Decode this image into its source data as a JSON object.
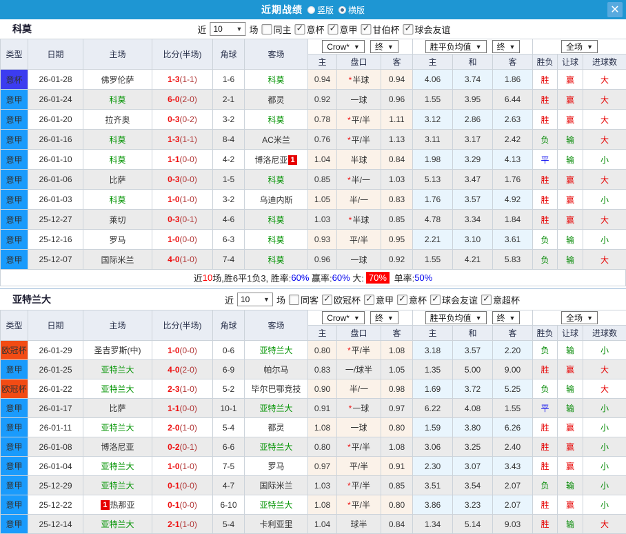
{
  "titlebar": {
    "title": "近期战绩",
    "radio_vertical": "竖版",
    "radio_horizontal": "横版",
    "close": "✕"
  },
  "filter_labels": {
    "near": "近",
    "count": "10",
    "games": "场"
  },
  "columns": {
    "type": "类型",
    "date": "日期",
    "home": "主场",
    "score": "比分(半场)",
    "corner": "角球",
    "away": "客场",
    "sub": [
      "主",
      "盘口",
      "客",
      "主",
      "和",
      "客",
      "胜负",
      "让球",
      "进球数"
    ]
  },
  "dropdowns": {
    "bookmaker": "Crow*",
    "final1": "终",
    "avg": "胜平负均值",
    "final2": "终",
    "scope": "全场"
  },
  "league_colors": {
    "意甲": "#1a9bfc",
    "意杯": "#3c3cf0",
    "欧冠杯": "#f24b14"
  },
  "result_colors": {
    "胜": "#e60000",
    "赢": "#e60000",
    "大": "#e60000",
    "负": "#008800",
    "输": "#008800",
    "小": "#008800",
    "平": "#0000ee"
  },
  "sections": [
    {
      "team": "科莫",
      "filter": {
        "same": "同主",
        "leagues": [
          "意杯",
          "意甲",
          "甘伯杯",
          "球会友谊"
        ]
      },
      "rows": [
        {
          "lg": "意杯",
          "date": "26-01-28",
          "home": "佛罗伦萨",
          "score": "1-3",
          "half": "1-1",
          "corner": "1-6",
          "away": "科莫",
          "o1": "0.94",
          "star": true,
          "hc": "半球",
          "o2": "0.94",
          "a1": "4.06",
          "a2": "3.74",
          "a3": "1.86",
          "r1": "胜",
          "r2": "赢",
          "r3": "大"
        },
        {
          "lg": "意甲",
          "date": "26-01-24",
          "home": "科莫",
          "score": "6-0",
          "half": "2-0",
          "corner": "2-1",
          "away": "都灵",
          "o1": "0.92",
          "star": false,
          "hc": "一球",
          "o2": "0.96",
          "a1": "1.55",
          "a2": "3.95",
          "a3": "6.44",
          "r1": "胜",
          "r2": "赢",
          "r3": "大"
        },
        {
          "lg": "意甲",
          "date": "26-01-20",
          "home": "拉齐奥",
          "score": "0-3",
          "half": "0-2",
          "corner": "3-2",
          "away": "科莫",
          "o1": "0.78",
          "star": true,
          "hc": "平/半",
          "o2": "1.11",
          "a1": "3.12",
          "a2": "2.86",
          "a3": "2.63",
          "r1": "胜",
          "r2": "赢",
          "r3": "大"
        },
        {
          "lg": "意甲",
          "date": "26-01-16",
          "home": "科莫",
          "score": "1-3",
          "half": "1-1",
          "corner": "8-4",
          "away": "AC米兰",
          "o1": "0.76",
          "star": true,
          "hc": "平/半",
          "o2": "1.13",
          "a1": "3.11",
          "a2": "3.17",
          "a3": "2.42",
          "r1": "负",
          "r2": "输",
          "r3": "大"
        },
        {
          "lg": "意甲",
          "date": "26-01-10",
          "home": "科莫",
          "score": "1-1",
          "half": "0-0",
          "corner": "4-2",
          "away": "博洛尼亚",
          "arc": "1",
          "arc_pos": "right",
          "o1": "1.04",
          "star": false,
          "hc": "半球",
          "o2": "0.84",
          "a1": "1.98",
          "a2": "3.29",
          "a3": "4.13",
          "r1": "平",
          "r2": "输",
          "r3": "小"
        },
        {
          "lg": "意甲",
          "date": "26-01-06",
          "home": "比萨",
          "score": "0-3",
          "half": "0-0",
          "corner": "1-5",
          "away": "科莫",
          "o1": "0.85",
          "star": true,
          "hc": "半/一",
          "o2": "1.03",
          "a1": "5.13",
          "a2": "3.47",
          "a3": "1.76",
          "r1": "胜",
          "r2": "赢",
          "r3": "大"
        },
        {
          "lg": "意甲",
          "date": "26-01-03",
          "home": "科莫",
          "score": "1-0",
          "half": "1-0",
          "corner": "3-2",
          "away": "乌迪内斯",
          "o1": "1.05",
          "star": false,
          "hc": "半/一",
          "o2": "0.83",
          "a1": "1.76",
          "a2": "3.57",
          "a3": "4.92",
          "r1": "胜",
          "r2": "赢",
          "r3": "小"
        },
        {
          "lg": "意甲",
          "date": "25-12-27",
          "home": "莱切",
          "score": "0-3",
          "half": "0-1",
          "corner": "4-6",
          "away": "科莫",
          "o1": "1.03",
          "star": true,
          "hc": "半球",
          "o2": "0.85",
          "a1": "4.78",
          "a2": "3.34",
          "a3": "1.84",
          "r1": "胜",
          "r2": "赢",
          "r3": "大"
        },
        {
          "lg": "意甲",
          "date": "25-12-16",
          "home": "罗马",
          "score": "1-0",
          "half": "0-0",
          "corner": "6-3",
          "away": "科莫",
          "o1": "0.93",
          "star": false,
          "hc": "平/半",
          "o2": "0.95",
          "a1": "2.21",
          "a2": "3.10",
          "a3": "3.61",
          "r1": "负",
          "r2": "输",
          "r3": "小"
        },
        {
          "lg": "意甲",
          "date": "25-12-07",
          "home": "国际米兰",
          "score": "4-0",
          "half": "1-0",
          "corner": "7-4",
          "away": "科莫",
          "o1": "0.96",
          "star": false,
          "hc": "一球",
          "o2": "0.92",
          "a1": "1.55",
          "a2": "4.21",
          "a3": "5.83",
          "r1": "负",
          "r2": "输",
          "r3": "大"
        }
      ],
      "summary": [
        {
          "t": "近"
        },
        {
          "t": "10",
          "s": "red"
        },
        {
          "t": "场,胜6平1负3, 胜率:"
        },
        {
          "t": "60%",
          "s": "blue"
        },
        {
          "t": " 赢率:"
        },
        {
          "t": "60%",
          "s": "blue"
        },
        {
          "t": " 大:"
        },
        {
          "t": "70%",
          "s": "redbg"
        },
        {
          "t": " 单率:"
        },
        {
          "t": "50%",
          "s": "blue"
        }
      ]
    },
    {
      "team": "亚特兰大",
      "filter": {
        "same": "同客",
        "leagues": [
          "欧冠杯",
          "意甲",
          "意杯",
          "球会友谊",
          "意超杯"
        ]
      },
      "rows": [
        {
          "lg": "欧冠杯",
          "date": "26-01-29",
          "home": "圣吉罗斯(中)",
          "score": "1-0",
          "half": "0-0",
          "corner": "0-6",
          "away": "亚特兰大",
          "o1": "0.80",
          "star": true,
          "hc": "平/半",
          "o2": "1.08",
          "a1": "3.18",
          "a2": "3.57",
          "a3": "2.20",
          "r1": "负",
          "r2": "输",
          "r3": "小"
        },
        {
          "lg": "意甲",
          "date": "26-01-25",
          "home": "亚特兰大",
          "score": "4-0",
          "half": "2-0",
          "corner": "6-9",
          "away": "帕尔马",
          "o1": "0.83",
          "star": false,
          "hc": "一/球半",
          "o2": "1.05",
          "a1": "1.35",
          "a2": "5.00",
          "a3": "9.00",
          "r1": "胜",
          "r2": "赢",
          "r3": "大"
        },
        {
          "lg": "欧冠杯",
          "date": "26-01-22",
          "home": "亚特兰大",
          "score": "2-3",
          "half": "1-0",
          "corner": "5-2",
          "away": "毕尔巴鄂竞技",
          "o1": "0.90",
          "star": false,
          "hc": "半/一",
          "o2": "0.98",
          "a1": "1.69",
          "a2": "3.72",
          "a3": "5.25",
          "r1": "负",
          "r2": "输",
          "r3": "大"
        },
        {
          "lg": "意甲",
          "date": "26-01-17",
          "home": "比萨",
          "score": "1-1",
          "half": "0-0",
          "corner": "10-1",
          "away": "亚特兰大",
          "o1": "0.91",
          "star": true,
          "hc": "一球",
          "o2": "0.97",
          "a1": "6.22",
          "a2": "4.08",
          "a3": "1.55",
          "r1": "平",
          "r2": "输",
          "r3": "小"
        },
        {
          "lg": "意甲",
          "date": "26-01-11",
          "home": "亚特兰大",
          "score": "2-0",
          "half": "1-0",
          "corner": "5-4",
          "away": "都灵",
          "o1": "1.08",
          "star": false,
          "hc": "一球",
          "o2": "0.80",
          "a1": "1.59",
          "a2": "3.80",
          "a3": "6.26",
          "r1": "胜",
          "r2": "赢",
          "r3": "小"
        },
        {
          "lg": "意甲",
          "date": "26-01-08",
          "home": "博洛尼亚",
          "score": "0-2",
          "half": "0-1",
          "corner": "6-6",
          "away": "亚特兰大",
          "o1": "0.80",
          "star": true,
          "hc": "平/半",
          "o2": "1.08",
          "a1": "3.06",
          "a2": "3.25",
          "a3": "2.40",
          "r1": "胜",
          "r2": "赢",
          "r3": "小"
        },
        {
          "lg": "意甲",
          "date": "26-01-04",
          "home": "亚特兰大",
          "score": "1-0",
          "half": "1-0",
          "corner": "7-5",
          "away": "罗马",
          "o1": "0.97",
          "star": false,
          "hc": "平/半",
          "o2": "0.91",
          "a1": "2.30",
          "a2": "3.07",
          "a3": "3.43",
          "r1": "胜",
          "r2": "赢",
          "r3": "小"
        },
        {
          "lg": "意甲",
          "date": "25-12-29",
          "home": "亚特兰大",
          "score": "0-1",
          "half": "0-0",
          "corner": "4-7",
          "away": "国际米兰",
          "o1": "1.03",
          "star": true,
          "hc": "平/半",
          "o2": "0.85",
          "a1": "3.51",
          "a2": "3.54",
          "a3": "2.07",
          "r1": "负",
          "r2": "输",
          "r3": "小"
        },
        {
          "lg": "意甲",
          "date": "25-12-22",
          "home": "热那亚",
          "hrc": "1",
          "hrc_pos": "left",
          "score": "0-1",
          "half": "0-0",
          "corner": "6-10",
          "away": "亚特兰大",
          "o1": "1.08",
          "star": true,
          "hc": "平/半",
          "o2": "0.80",
          "a1": "3.86",
          "a2": "3.23",
          "a3": "2.07",
          "r1": "胜",
          "r2": "赢",
          "r3": "小"
        },
        {
          "lg": "意甲",
          "date": "25-12-14",
          "home": "亚特兰大",
          "score": "2-1",
          "half": "1-0",
          "corner": "5-4",
          "away": "卡利亚里",
          "o1": "1.04",
          "star": false,
          "hc": "球半",
          "o2": "0.84",
          "a1": "1.34",
          "a2": "5.14",
          "a3": "9.03",
          "r1": "胜",
          "r2": "输",
          "r3": "大"
        }
      ]
    }
  ]
}
